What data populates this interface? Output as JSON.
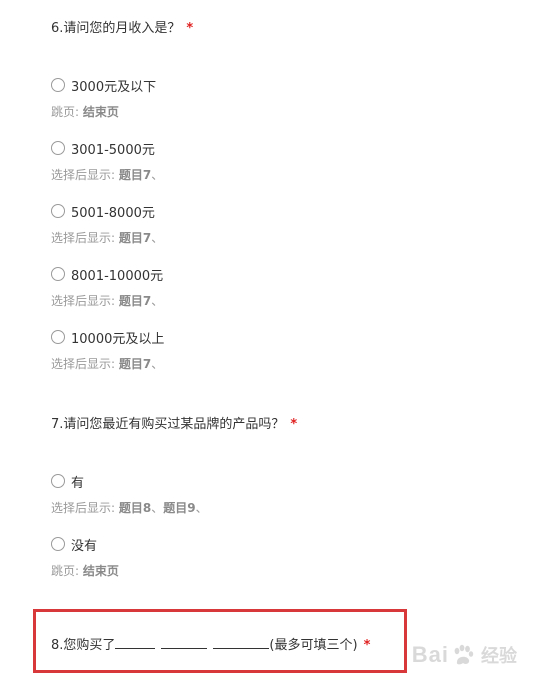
{
  "questions": {
    "q6": {
      "title": "6.请问您的月收入是？",
      "required_mark": "*",
      "options": [
        {
          "label": "3000元及以下",
          "meta_label": "跳页: ",
          "meta_value": "结束页"
        },
        {
          "label": "3001-5000元",
          "meta_label": "选择后显示: ",
          "meta_value": "题目7",
          "meta_suffix": "、"
        },
        {
          "label": "5001-8000元",
          "meta_label": "选择后显示: ",
          "meta_value": "题目7",
          "meta_suffix": "、"
        },
        {
          "label": "8001-10000元",
          "meta_label": "选择后显示: ",
          "meta_value": "题目7",
          "meta_suffix": "、"
        },
        {
          "label": "10000元及以上",
          "meta_label": "选择后显示: ",
          "meta_value": "题目7",
          "meta_suffix": "、"
        }
      ]
    },
    "q7": {
      "title": "7.请问您最近有购买过某品牌的产品吗？",
      "required_mark": "*",
      "options": [
        {
          "label": "有",
          "meta_label": "选择后显示: ",
          "meta_value": "题目8",
          "meta_suffix": "、",
          "meta_value2": "题目9",
          "meta_suffix2": "、"
        },
        {
          "label": "没有",
          "meta_label": "跳页: ",
          "meta_value": "结束页"
        }
      ]
    },
    "q8": {
      "prefix": "8.您购买了",
      "suffix": "(最多可填三个)",
      "required_mark": "*"
    }
  },
  "watermark": {
    "brand_text": "Bai",
    "brand_text2": "",
    "cn_text": "经验"
  }
}
